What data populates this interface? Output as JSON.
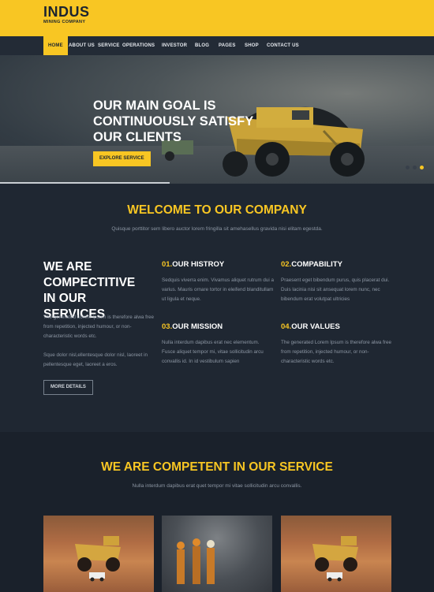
{
  "brand": {
    "name": "INDUS",
    "tagline": "MINING COMPANY"
  },
  "nav": {
    "items": [
      {
        "label": "HOME",
        "active": true
      },
      {
        "label": "ABOUT US"
      },
      {
        "label": "SERVICE"
      },
      {
        "label": "OPERATIONS"
      },
      {
        "label": "INVESTOR"
      },
      {
        "label": "BLOG"
      },
      {
        "label": "PAGES"
      },
      {
        "label": "SHOP"
      },
      {
        "label": "CONTACT US"
      }
    ]
  },
  "hero": {
    "title": "OUR MAIN GOAL IS CONTINUOUSLY SATISFY OUR CLIENTS",
    "button_label": "EXPLORE SERVICE",
    "slide_count": 3,
    "active_slide": 3,
    "progress": 0.39
  },
  "welcome": {
    "title": "WELCOME TO OUR COMPANY",
    "subtitle": "Quisque porttitor sem libero auctor lorem fringilla sit amehasellus gravida nisi elitam egestda.",
    "heading": "WE ARE COMPECTITIVE IN OUR SERVICES",
    "paragraph1": "The generated Lorem Ipsum is therefore alwa free from repetition, injected humour, or non-characteristic words etc.",
    "paragraph2": "Sque dolor nisl,ellentesque dolor nisl, laoreet in pellentesque eget, laoreet a eros.",
    "more_button": "MORE DETAILS",
    "features": [
      {
        "number": "01.",
        "title": "OUR HISTROY",
        "text": "Sedquis viverra enim. Vivamus aliquet rutrum dui a varius. Mauris ornare tortor in eleifend blanditullam ut ligula et neque."
      },
      {
        "number": "02.",
        "title": "COMPABILITY",
        "text": "Praesent eget bibendum purus, quis placerat dui. Duis lacinia nisi sit ansequat lorem nunc, nec bibendum erat volutpat ultricies"
      },
      {
        "number": "03.",
        "title": "OUR MISSION",
        "text": "Nulla interdum dapibus erat nec elementum. Fusce aliquet tempor mi, vitae sollicitudin arcu convallis id. In id vestibulum sapien"
      },
      {
        "number": "04.",
        "title": "OUR VALUES",
        "text": "The generated Lorem Ipsum is therefore alwa free from repetition, injected humour, or non-characteristic words etc."
      }
    ]
  },
  "service": {
    "title": "WE ARE COMPETENT IN OUR SERVICE",
    "subtitle": "Nulla interdum dapibus erat quet tempor mi vitae sollicitudin arcu convallis."
  },
  "colors": {
    "accent": "#f8c623",
    "dark_bg": "#1f2732",
    "nav_bg": "#232b36",
    "text_muted": "#8c96a3"
  }
}
